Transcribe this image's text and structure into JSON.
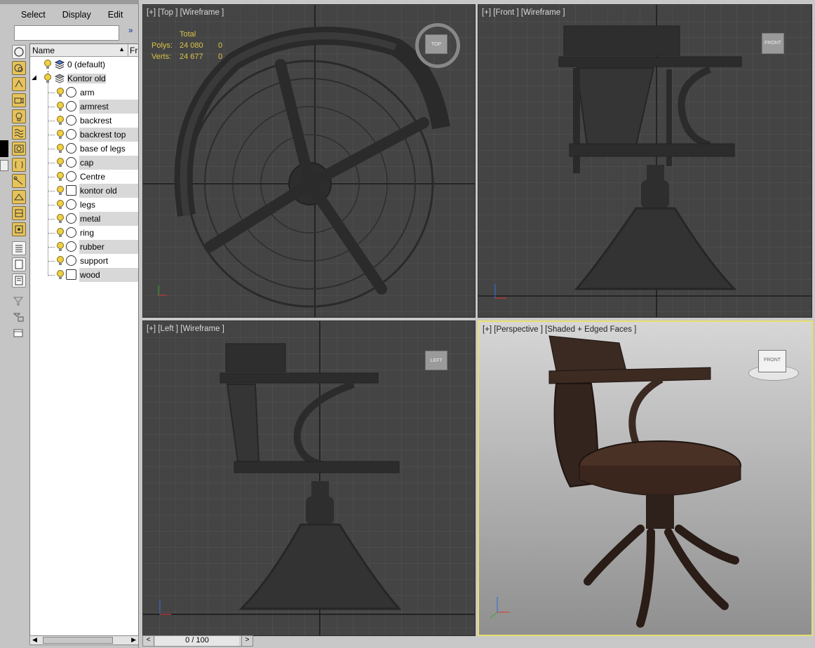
{
  "menu": {
    "select": "Select",
    "display": "Display",
    "edit": "Edit"
  },
  "search": {
    "placeholder": "",
    "more": "»"
  },
  "columns": {
    "name": "Name",
    "sort_indicator": "▲",
    "frozen": "Fr"
  },
  "layers": [
    {
      "label": "0 (default)"
    },
    {
      "label": "Kontor old"
    }
  ],
  "objects": [
    {
      "label": "arm"
    },
    {
      "label": "armrest"
    },
    {
      "label": "backrest"
    },
    {
      "label": "backrest top"
    },
    {
      "label": "base of legs"
    },
    {
      "label": "cap"
    },
    {
      "label": "Centre"
    },
    {
      "label": "kontor old"
    },
    {
      "label": "legs"
    },
    {
      "label": "metal"
    },
    {
      "label": "ring"
    },
    {
      "label": "rubber"
    },
    {
      "label": "support"
    },
    {
      "label": "wood"
    }
  ],
  "viewports": {
    "top": {
      "label": "[+] [Top ] [Wireframe ]",
      "cube": "TOP"
    },
    "front": {
      "label": "[+] [Front ] [Wireframe ]",
      "cube": "FRONT"
    },
    "left": {
      "label": "[+] [Left ] [Wireframe ]",
      "cube": "LEFT"
    },
    "perspective": {
      "label": "[+] [Perspective ] [Shaded + Edged Faces ]",
      "cube": "FRONT"
    }
  },
  "stats": {
    "total": "Total",
    "polys_label": "Polys:",
    "polys_total": "24 080",
    "polys_sel": "0",
    "verts_label": "Verts:",
    "verts_total": "24 677",
    "verts_sel": "0"
  },
  "timeline": {
    "frame": "0 / 100",
    "prev": "<",
    "next": ">"
  },
  "colors": {
    "viewport_bg": "#444444",
    "active_border": "#e8e070",
    "stats_text": "#d9c54a",
    "toolbar_accent": "#e6c35a"
  }
}
